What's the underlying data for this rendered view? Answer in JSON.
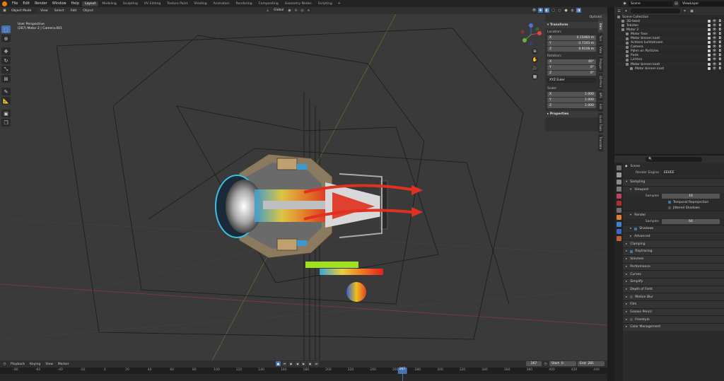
{
  "topbar": {
    "menus": [
      "File",
      "Edit",
      "Render",
      "Window",
      "Help"
    ],
    "workspaces": [
      "Layout",
      "Modeling",
      "Sculpting",
      "UV Editing",
      "Texture Paint",
      "Shading",
      "Animation",
      "Rendering",
      "Compositing",
      "Geometry Nodes",
      "Scripting"
    ],
    "active_workspace": "Layout",
    "plus": "+",
    "scene": "Scene",
    "view_layer": "ViewLayer"
  },
  "viewport": {
    "mode": "Object Mode",
    "menus": [
      "View",
      "Select",
      "Add",
      "Object"
    ],
    "orientation": "Global",
    "options": "Options",
    "overlay_line1": "User Perspective",
    "overlay_line2": "(267) Motor 2 | Camera.001"
  },
  "npanel": {
    "transform": "Transform",
    "location_label": "Location:",
    "location": [
      {
        "k": "X",
        "v": "0.15464 m"
      },
      {
        "k": "Y",
        "v": "-3.7103 m"
      },
      {
        "k": "Z",
        "v": "0.9158 m"
      }
    ],
    "rotation_label": "Rotation:",
    "rotation": [
      {
        "k": "X",
        "v": "40°"
      },
      {
        "k": "Y",
        "v": "0°"
      },
      {
        "k": "Z",
        "v": "0°"
      }
    ],
    "rotation_mode": "XYZ Euler",
    "scale_label": "Scale:",
    "scale": [
      {
        "k": "X",
        "v": "1.000"
      },
      {
        "k": "Y",
        "v": "1.000"
      },
      {
        "k": "Z",
        "v": "1.000"
      }
    ],
    "properties": "Properties",
    "tabs": [
      "Item",
      "Tool",
      "View",
      "Polygon",
      "3D-Print",
      "BPS",
      "Edit",
      "Quick Tools",
      "Translate"
    ]
  },
  "outliner": {
    "search_placeholder": "",
    "items": [
      {
        "name": "Scene Collection",
        "indent": 0,
        "sel": false
      },
      {
        "name": "3D-tekst",
        "indent": 1,
        "sel": false
      },
      {
        "name": "Teksten",
        "indent": 1,
        "sel": false
      },
      {
        "name": "Motor 2",
        "indent": 1,
        "sel": false
      },
      {
        "name": "Motor fase",
        "indent": 2,
        "sel": false
      },
      {
        "name": "Motor binnen kant",
        "indent": 2,
        "sel": false
      },
      {
        "name": "Achtere luchtstroom",
        "indent": 2,
        "sel": false
      },
      {
        "name": "Camera",
        "indent": 2,
        "sel": false
      },
      {
        "name": "Pijlen en Particles",
        "indent": 2,
        "sel": false
      },
      {
        "name": "Punk",
        "indent": 2,
        "sel": false
      },
      {
        "name": "Lichten",
        "indent": 2,
        "sel": false
      },
      {
        "name": "Motor binnen kant",
        "indent": 2,
        "sel": false
      },
      {
        "name": "Motor binnen kant",
        "indent": 3,
        "sel": false
      }
    ]
  },
  "properties": {
    "breadcrumb": "Scene",
    "render_engine_label": "Render Engine",
    "render_engine": "EEVEE",
    "sampling": "Sampling",
    "viewport": "Viewport",
    "samples_label": "Samples",
    "viewport_samples": "16",
    "temporal_reprojection": "Temporal Reprojection",
    "jittered_shadows": "Jittered Shadows",
    "render": "Render",
    "render_samples": "64",
    "shadows": "Shadows",
    "advanced": "Advanced",
    "panels": [
      "Clamping",
      "Raytracing",
      "Volumes",
      "Performance",
      "Curves",
      "Simplify",
      "Depth of Field",
      "Motion Blur",
      "Film",
      "Grease Pencil",
      "Freestyle",
      "Color Management"
    ]
  },
  "timeline": {
    "menus": [
      "Playback",
      "Keying",
      "View",
      "Marker"
    ],
    "current_frame": "267",
    "start_label": "Start",
    "start": "0",
    "end_label": "End",
    "end": "281",
    "ruler": [
      "-80",
      "-60",
      "-40",
      "-20",
      "0",
      "20",
      "40",
      "60",
      "80",
      "100",
      "120",
      "140",
      "160",
      "180",
      "200",
      "220",
      "240",
      "260",
      "280",
      "300",
      "320",
      "340",
      "360",
      "380",
      "400",
      "420",
      "440"
    ]
  }
}
